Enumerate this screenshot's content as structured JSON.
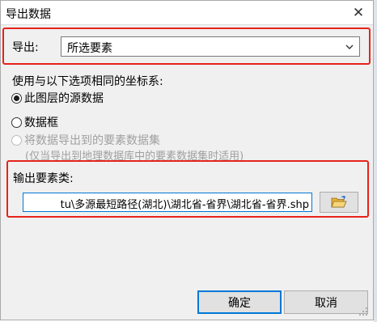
{
  "dialog": {
    "title": "导出数据",
    "close_icon": "close-icon"
  },
  "export": {
    "label": "导出:",
    "selected": "所选要素",
    "dropdown_icon": "chevron-down-icon"
  },
  "coordinate": {
    "label": "使用与以下选项相同的坐标系:",
    "options": [
      {
        "label": "此图层的源数据",
        "checked": true,
        "enabled": true
      },
      {
        "label": "数据框",
        "checked": false,
        "enabled": true
      },
      {
        "label": "将数据导出到的要素数据集",
        "checked": false,
        "enabled": false
      }
    ],
    "note": "(仅当导出到地理数据库中的要素数据集时适用)"
  },
  "output": {
    "label": "输出要素类:",
    "path": "tu\\多源最短路径(湖北)\\湖北省-省界\\湖北省-省界.shp",
    "browse_icon": "folder-open-icon"
  },
  "buttons": {
    "ok": "确定",
    "cancel": "取消"
  },
  "colors": {
    "highlight": "#e6231c",
    "focus": "#0078d7"
  }
}
